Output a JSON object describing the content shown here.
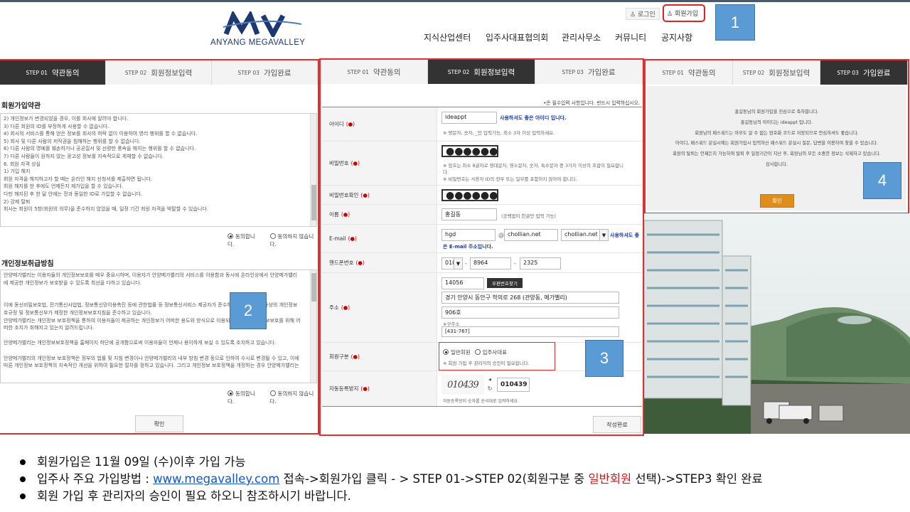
{
  "header": {
    "logo_brand": "ANYANG MEGAVALLEY",
    "login": "로그인",
    "join": "회원가입",
    "nav": [
      "지식산업센터",
      "입주사대표협의회",
      "관리사무소",
      "커뮤니티",
      "공지사항"
    ]
  },
  "callouts": [
    "1",
    "2",
    "3",
    "4"
  ],
  "steps": [
    {
      "num": "STEP 01",
      "label": "약관동의"
    },
    {
      "num": "STEP 02",
      "label": "회원정보입력"
    },
    {
      "num": "STEP 03",
      "label": "가입완료"
    }
  ],
  "terms": {
    "title": "회원가입약관",
    "lines": [
      "2) 개인정보가 변경되었을 경우, 이를 회사에 알려야 합니다.",
      "3) 다른 회원의 ID를 부정하게 사용할 수 없습니다.",
      "4) 회사의 서비스를 통해 얻은 정보를 회사의 허락 없이 이용하여 영리 행위를 할 수 없습니다.",
      "5) 회사 및 다른 사람의 저작권을 침해하는 행위를 할 수 없습니다.",
      "6) 다른 사람의 명예를 훼손하거나 공공질서 및 선량한 풍속을 해치는 행위를 할 수 없습니다.",
      "7) 다른 사람들이 원하지 않는 광고성 정보를 지속적으로 게재할 수 없습니다.",
      "6. 회원 자격 상실",
      "1) 가입 해지",
      "회원 자격을 해지하고자 할 때는 온라인 해지 신청서를 제출하면 됩니다.",
      "회원 해지를 한 후에도 언제든지 재가입을 할 수 있습니다.",
      "다만 해지된 후 한 달 안에는 전과 동일한 ID로 가입할 수 없습니다.",
      "2) 강제 탈퇴",
      "회사는 회원이 5항(회원의 의무)을 준수하지 않았을 때, 일정 기간 회원 자격을 박탈할 수 있습니다."
    ],
    "agree": "동의합니다.",
    "disagree": "동의하지 않습니다."
  },
  "privacy": {
    "title": "개인정보취급방침",
    "lines": [
      "안양메가밸리는 이용자들의 개인정보보호를 매우 중요시하며, 이용자가 안양메가밸리의 서비스를 이용함과 동시에 온라인상에서 안양메가밸리",
      "에 제공한 개인정보가 보호받을 수 있도록 최선을 다하고 있습니다.",
      "",
      "",
      "이에 동신비밀보호법, 전기통신사업법, 정보통신망이용촉진 등에 관한법률 등 정보통신서비스 제공자가 준수하여야 할 관련 법규상의 개인정보",
      "호규정 및 정보통신부가 제정한 개인정보보호지침을 준수하고 있습니다.",
      "안양메가밸리는 개인정보 보호정책을 통하여 이용자들이 제공하는 개인정보가 어떠한 용도와 방식으로 이용되고 있으며 개인정보보호를 위해 어",
      "떠한 조치가 취해지고 있는지 알려드립니다.",
      "",
      "안양메가밸리는 개인정보보호정책을 홈페이지 하단에 공개함으로써 이용자들이 언제나 용이하게 보실 수 있도록 조치하고 있습니다.",
      "",
      "안양메가밸리의 개인정보 보호정책은 정부의 법률 및 지침 변경이나 안양메가밸리의 내부 방침 변경 등으로 인하여 수시로 변경될 수 있고, 이에",
      "따른 개인정보 보호정책의 지속적인 개선을 위하여 필요한 절차를 정하고 있습니다. 그리고 개인정보 보호정책을 개정하는 경우 안양메가밸리는"
    ],
    "agree": "동의합니다.",
    "disagree": "동의하지 않습니다.",
    "confirm": "확인"
  },
  "form": {
    "required_note": "은 필수입력 사항입니다. 반드시 입력하십시오.",
    "req_mark": "(●)",
    "id_label": "아이디",
    "id_value": "ideappt",
    "id_ok": "사용하셔도 좋은 아이디 입니다.",
    "id_hint": "※ 영문자, 숫자, _만 입력가능, 최소 3자 이상 입력하세요.",
    "pw_label": "비밀번호",
    "pw_value": "●●●●●●●●●",
    "pw_hint1": "※ 암호는 최소 8글자로 영대문자, 영소문자, 숫자, 특수문자 중 3가지 이상의 조합이 필요합니",
    "pw_hint1b": "다.",
    "pw_hint2": "※ 비밀번호는 사용자 ID의 전부 또는 일부를 포함하지 않아야 합니다.",
    "pw2_label": "비밀번호확인",
    "pw2_value": "●●●●●●●●●",
    "name_label": "이름",
    "name_value": "홍길동",
    "name_hint": "(공백없이 한글만 입력 가능)",
    "email_label": "E-mail",
    "email_id": "hgd",
    "email_at": "@",
    "email_domain": "chollian.net",
    "email_select": "chollian.net",
    "email_ok1": "사용하셔도 좋",
    "email_ok2": "은 E-mail 주소입니다.",
    "phone_label": "핸드폰번호",
    "phone1": "010",
    "phone2": "8964",
    "phone3": "2325",
    "phone_dash": "-",
    "addr_label": "주소",
    "zip": "14056",
    "zip_btn": "우편번호찾기",
    "addr1": "경기 안양시 동안구 학의로 268 (관양동, 메가밸리)",
    "addr2": "906호",
    "old_addr_label": "※구주소",
    "old_addr": "[431-767]",
    "member_type_label": "회원구분",
    "member_type_general": "일반회원",
    "member_type_rep": "입주사대표",
    "member_type_note": "※ 회원 가입 후 관리자의 승인이 필요합니다.",
    "captcha_label": "자동등록방지",
    "captcha_img": "010439",
    "captcha_value": "010439",
    "captcha_hint": "자동등록방지 숫자를 순서대로 입력하세요.",
    "submit": "작성완료"
  },
  "complete": {
    "lines": [
      "홍길동님의 회원가입을 진심으로 축하합니다.",
      "홍길동님의 아이디는 ideappt 입니다.",
      "회원님의 패스워드는 아무도 알 수 없는 암호화 코드로 저장되므로 안심하셔도 좋습니다.",
      "아이디, 패스워드 분실시에는 회원가입시 입력하신 패스워드 분실시 질문, 답변을 이용하여 찾을 수 있습니다.",
      "회원의 탈퇴는 언제든지 가능하며 탈퇴 후 일정기간이 지난 후, 회원님의 모든 소중한 정보는 삭제하고 있습니다.",
      "감사합니다."
    ],
    "confirm": "확인"
  },
  "notes": {
    "line1": "회원가입은 11월 09일 (수)이후 가입 가능",
    "line2_prefix": "입주사 주요 가입방법 : ",
    "line2_link": "www.megavalley.com",
    "line2_mid": " 접속->회원가입 클릭 - > STEP 01->STEP 02(회원구분 중 ",
    "line2_red": "일반회원",
    "line2_suffix": " 선택)->STEP3 확인 완료",
    "line3": "회원 가입 후 관리자의 승인이 필요 하오니 참조하시기 바랍니다."
  },
  "colors": {
    "highlight_border": "#e23030",
    "callout_fill": "#5b9bd5",
    "active_step": "#333333",
    "confirm_orange": "#e08e1b",
    "link_blue": "#1155cc",
    "note_red": "#d01a1a"
  }
}
